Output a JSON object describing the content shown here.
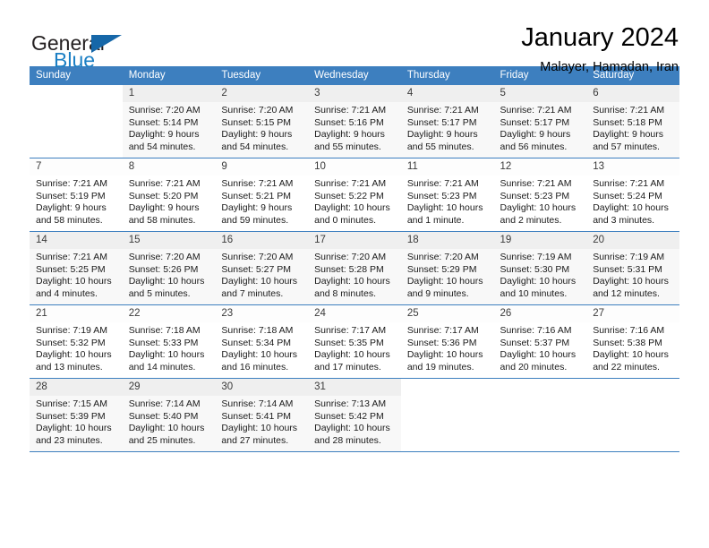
{
  "brand": {
    "word1": "General",
    "word2": "Blue",
    "logo_icon": "triangle-logo-icon",
    "accent_color": "#1b7fc4"
  },
  "header": {
    "title": "January 2024",
    "subtitle": "Malayer, Hamadan, Iran"
  },
  "calendar": {
    "header_bg": "#3d7fbf",
    "weekdays": [
      "Sunday",
      "Monday",
      "Tuesday",
      "Wednesday",
      "Thursday",
      "Friday",
      "Saturday"
    ],
    "weeks": [
      [
        {
          "day": "",
          "lines": []
        },
        {
          "day": "1",
          "lines": [
            "Sunrise: 7:20 AM",
            "Sunset: 5:14 PM",
            "Daylight: 9 hours",
            "and 54 minutes."
          ]
        },
        {
          "day": "2",
          "lines": [
            "Sunrise: 7:20 AM",
            "Sunset: 5:15 PM",
            "Daylight: 9 hours",
            "and 54 minutes."
          ]
        },
        {
          "day": "3",
          "lines": [
            "Sunrise: 7:21 AM",
            "Sunset: 5:16 PM",
            "Daylight: 9 hours",
            "and 55 minutes."
          ]
        },
        {
          "day": "4",
          "lines": [
            "Sunrise: 7:21 AM",
            "Sunset: 5:17 PM",
            "Daylight: 9 hours",
            "and 55 minutes."
          ]
        },
        {
          "day": "5",
          "lines": [
            "Sunrise: 7:21 AM",
            "Sunset: 5:17 PM",
            "Daylight: 9 hours",
            "and 56 minutes."
          ]
        },
        {
          "day": "6",
          "lines": [
            "Sunrise: 7:21 AM",
            "Sunset: 5:18 PM",
            "Daylight: 9 hours",
            "and 57 minutes."
          ]
        }
      ],
      [
        {
          "day": "7",
          "lines": [
            "Sunrise: 7:21 AM",
            "Sunset: 5:19 PM",
            "Daylight: 9 hours",
            "and 58 minutes."
          ]
        },
        {
          "day": "8",
          "lines": [
            "Sunrise: 7:21 AM",
            "Sunset: 5:20 PM",
            "Daylight: 9 hours",
            "and 58 minutes."
          ]
        },
        {
          "day": "9",
          "lines": [
            "Sunrise: 7:21 AM",
            "Sunset: 5:21 PM",
            "Daylight: 9 hours",
            "and 59 minutes."
          ]
        },
        {
          "day": "10",
          "lines": [
            "Sunrise: 7:21 AM",
            "Sunset: 5:22 PM",
            "Daylight: 10 hours",
            "and 0 minutes."
          ]
        },
        {
          "day": "11",
          "lines": [
            "Sunrise: 7:21 AM",
            "Sunset: 5:23 PM",
            "Daylight: 10 hours",
            "and 1 minute."
          ]
        },
        {
          "day": "12",
          "lines": [
            "Sunrise: 7:21 AM",
            "Sunset: 5:23 PM",
            "Daylight: 10 hours",
            "and 2 minutes."
          ]
        },
        {
          "day": "13",
          "lines": [
            "Sunrise: 7:21 AM",
            "Sunset: 5:24 PM",
            "Daylight: 10 hours",
            "and 3 minutes."
          ]
        }
      ],
      [
        {
          "day": "14",
          "lines": [
            "Sunrise: 7:21 AM",
            "Sunset: 5:25 PM",
            "Daylight: 10 hours",
            "and 4 minutes."
          ]
        },
        {
          "day": "15",
          "lines": [
            "Sunrise: 7:20 AM",
            "Sunset: 5:26 PM",
            "Daylight: 10 hours",
            "and 5 minutes."
          ]
        },
        {
          "day": "16",
          "lines": [
            "Sunrise: 7:20 AM",
            "Sunset: 5:27 PM",
            "Daylight: 10 hours",
            "and 7 minutes."
          ]
        },
        {
          "day": "17",
          "lines": [
            "Sunrise: 7:20 AM",
            "Sunset: 5:28 PM",
            "Daylight: 10 hours",
            "and 8 minutes."
          ]
        },
        {
          "day": "18",
          "lines": [
            "Sunrise: 7:20 AM",
            "Sunset: 5:29 PM",
            "Daylight: 10 hours",
            "and 9 minutes."
          ]
        },
        {
          "day": "19",
          "lines": [
            "Sunrise: 7:19 AM",
            "Sunset: 5:30 PM",
            "Daylight: 10 hours",
            "and 10 minutes."
          ]
        },
        {
          "day": "20",
          "lines": [
            "Sunrise: 7:19 AM",
            "Sunset: 5:31 PM",
            "Daylight: 10 hours",
            "and 12 minutes."
          ]
        }
      ],
      [
        {
          "day": "21",
          "lines": [
            "Sunrise: 7:19 AM",
            "Sunset: 5:32 PM",
            "Daylight: 10 hours",
            "and 13 minutes."
          ]
        },
        {
          "day": "22",
          "lines": [
            "Sunrise: 7:18 AM",
            "Sunset: 5:33 PM",
            "Daylight: 10 hours",
            "and 14 minutes."
          ]
        },
        {
          "day": "23",
          "lines": [
            "Sunrise: 7:18 AM",
            "Sunset: 5:34 PM",
            "Daylight: 10 hours",
            "and 16 minutes."
          ]
        },
        {
          "day": "24",
          "lines": [
            "Sunrise: 7:17 AM",
            "Sunset: 5:35 PM",
            "Daylight: 10 hours",
            "and 17 minutes."
          ]
        },
        {
          "day": "25",
          "lines": [
            "Sunrise: 7:17 AM",
            "Sunset: 5:36 PM",
            "Daylight: 10 hours",
            "and 19 minutes."
          ]
        },
        {
          "day": "26",
          "lines": [
            "Sunrise: 7:16 AM",
            "Sunset: 5:37 PM",
            "Daylight: 10 hours",
            "and 20 minutes."
          ]
        },
        {
          "day": "27",
          "lines": [
            "Sunrise: 7:16 AM",
            "Sunset: 5:38 PM",
            "Daylight: 10 hours",
            "and 22 minutes."
          ]
        }
      ],
      [
        {
          "day": "28",
          "lines": [
            "Sunrise: 7:15 AM",
            "Sunset: 5:39 PM",
            "Daylight: 10 hours",
            "and 23 minutes."
          ]
        },
        {
          "day": "29",
          "lines": [
            "Sunrise: 7:14 AM",
            "Sunset: 5:40 PM",
            "Daylight: 10 hours",
            "and 25 minutes."
          ]
        },
        {
          "day": "30",
          "lines": [
            "Sunrise: 7:14 AM",
            "Sunset: 5:41 PM",
            "Daylight: 10 hours",
            "and 27 minutes."
          ]
        },
        {
          "day": "31",
          "lines": [
            "Sunrise: 7:13 AM",
            "Sunset: 5:42 PM",
            "Daylight: 10 hours",
            "and 28 minutes."
          ]
        },
        {
          "day": "",
          "lines": []
        },
        {
          "day": "",
          "lines": []
        },
        {
          "day": "",
          "lines": []
        }
      ]
    ]
  }
}
